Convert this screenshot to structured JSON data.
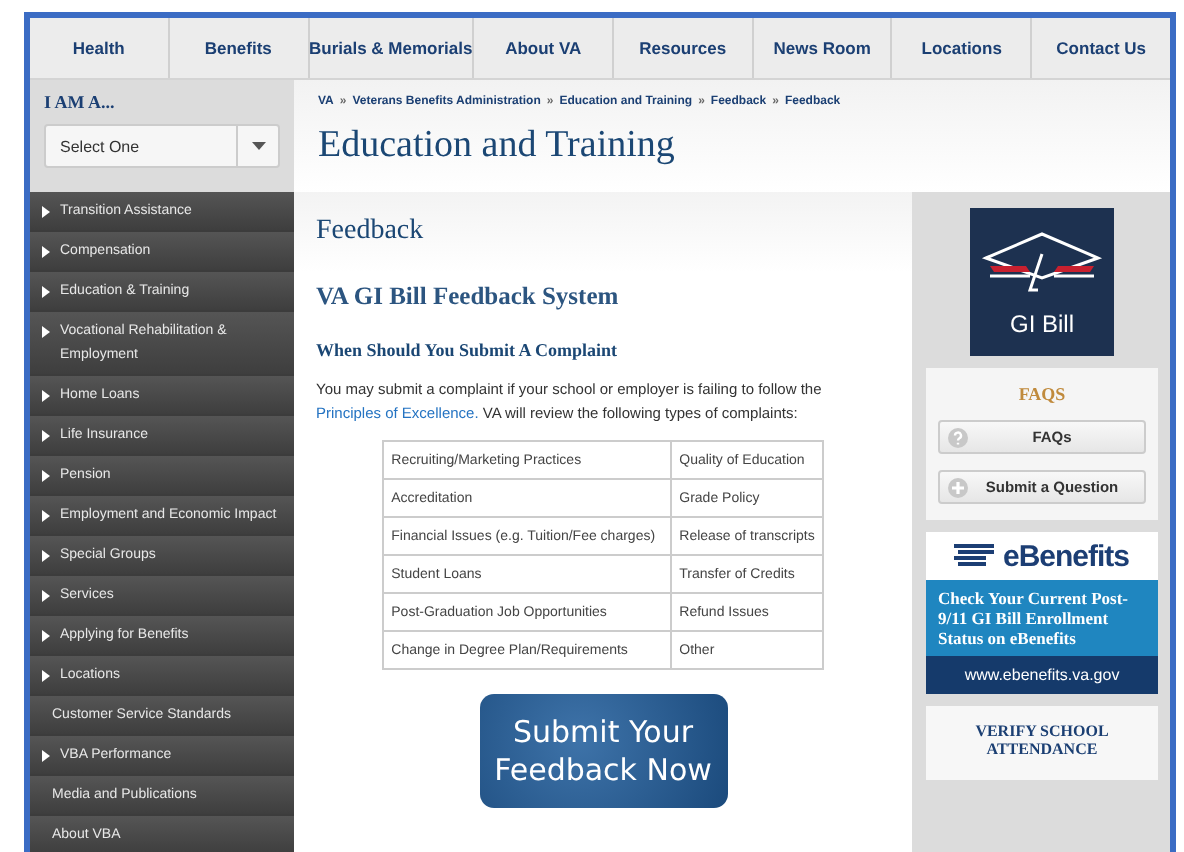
{
  "nav": [
    "Health",
    "Benefits",
    "Burials & Memorials",
    "About VA",
    "Resources",
    "News Room",
    "Locations",
    "Contact Us"
  ],
  "iam": {
    "label": "I AM A...",
    "select": "Select One"
  },
  "sidebar": [
    {
      "label": "Transition Assistance",
      "arrow": true
    },
    {
      "label": "Compensation",
      "arrow": true
    },
    {
      "label": "Education & Training",
      "arrow": true
    },
    {
      "label": "Vocational Rehabilitation & Employment",
      "arrow": true
    },
    {
      "label": "Home Loans",
      "arrow": true
    },
    {
      "label": "Life Insurance",
      "arrow": true
    },
    {
      "label": "Pension",
      "arrow": true
    },
    {
      "label": "Employment and Economic Impact",
      "arrow": true
    },
    {
      "label": "Special Groups",
      "arrow": true
    },
    {
      "label": "Services",
      "arrow": true
    },
    {
      "label": "Applying for Benefits",
      "arrow": true
    },
    {
      "label": "Locations",
      "arrow": true
    },
    {
      "label": "Customer Service Standards",
      "arrow": false
    },
    {
      "label": "VBA Performance",
      "arrow": true
    },
    {
      "label": "Media and Publications",
      "arrow": false
    },
    {
      "label": "About VBA",
      "arrow": false
    }
  ],
  "breadcrumbs": [
    "VA",
    "Veterans Benefits Administration",
    "Education and Training",
    "Feedback",
    "Feedback"
  ],
  "breadcrumb_separator": "»",
  "page_title": "Education and Training",
  "section_title": "Feedback",
  "heading": "VA GI Bill Feedback System",
  "subheading": "When Should You Submit A Complaint",
  "intro": "You may submit a complaint if your school or employer is failing to follow the",
  "intro_link": "Principles of Excellence.",
  "intro_end": "VA will review the following types of complaints:",
  "complaints": [
    [
      "Recruiting/Marketing Practices",
      "Quality of Education"
    ],
    [
      "Accreditation",
      "Grade Policy"
    ],
    [
      "Financial Issues (e.g. Tuition/Fee charges)",
      "Release of transcripts"
    ],
    [
      "Student Loans",
      "Transfer of Credits"
    ],
    [
      "Post-Graduation Job Opportunities",
      "Refund Issues"
    ],
    [
      "Change in Degree Plan/Requirements",
      "Other"
    ]
  ],
  "submit_button": "Submit Your Feedback Now",
  "gi_bill_logo": "GI Bill",
  "faqs": {
    "title": "FAQS",
    "buttons": [
      {
        "label": "FAQs"
      },
      {
        "label": "Submit a Question"
      }
    ]
  },
  "ebenefits": {
    "logo": "eBenefits",
    "message": "Check Your Current Post-9/11 GI Bill Enrollment Status on eBenefits",
    "url": "www.ebenefits.va.gov"
  },
  "verify": "VERIFY SCHOOL ATTENDANCE"
}
